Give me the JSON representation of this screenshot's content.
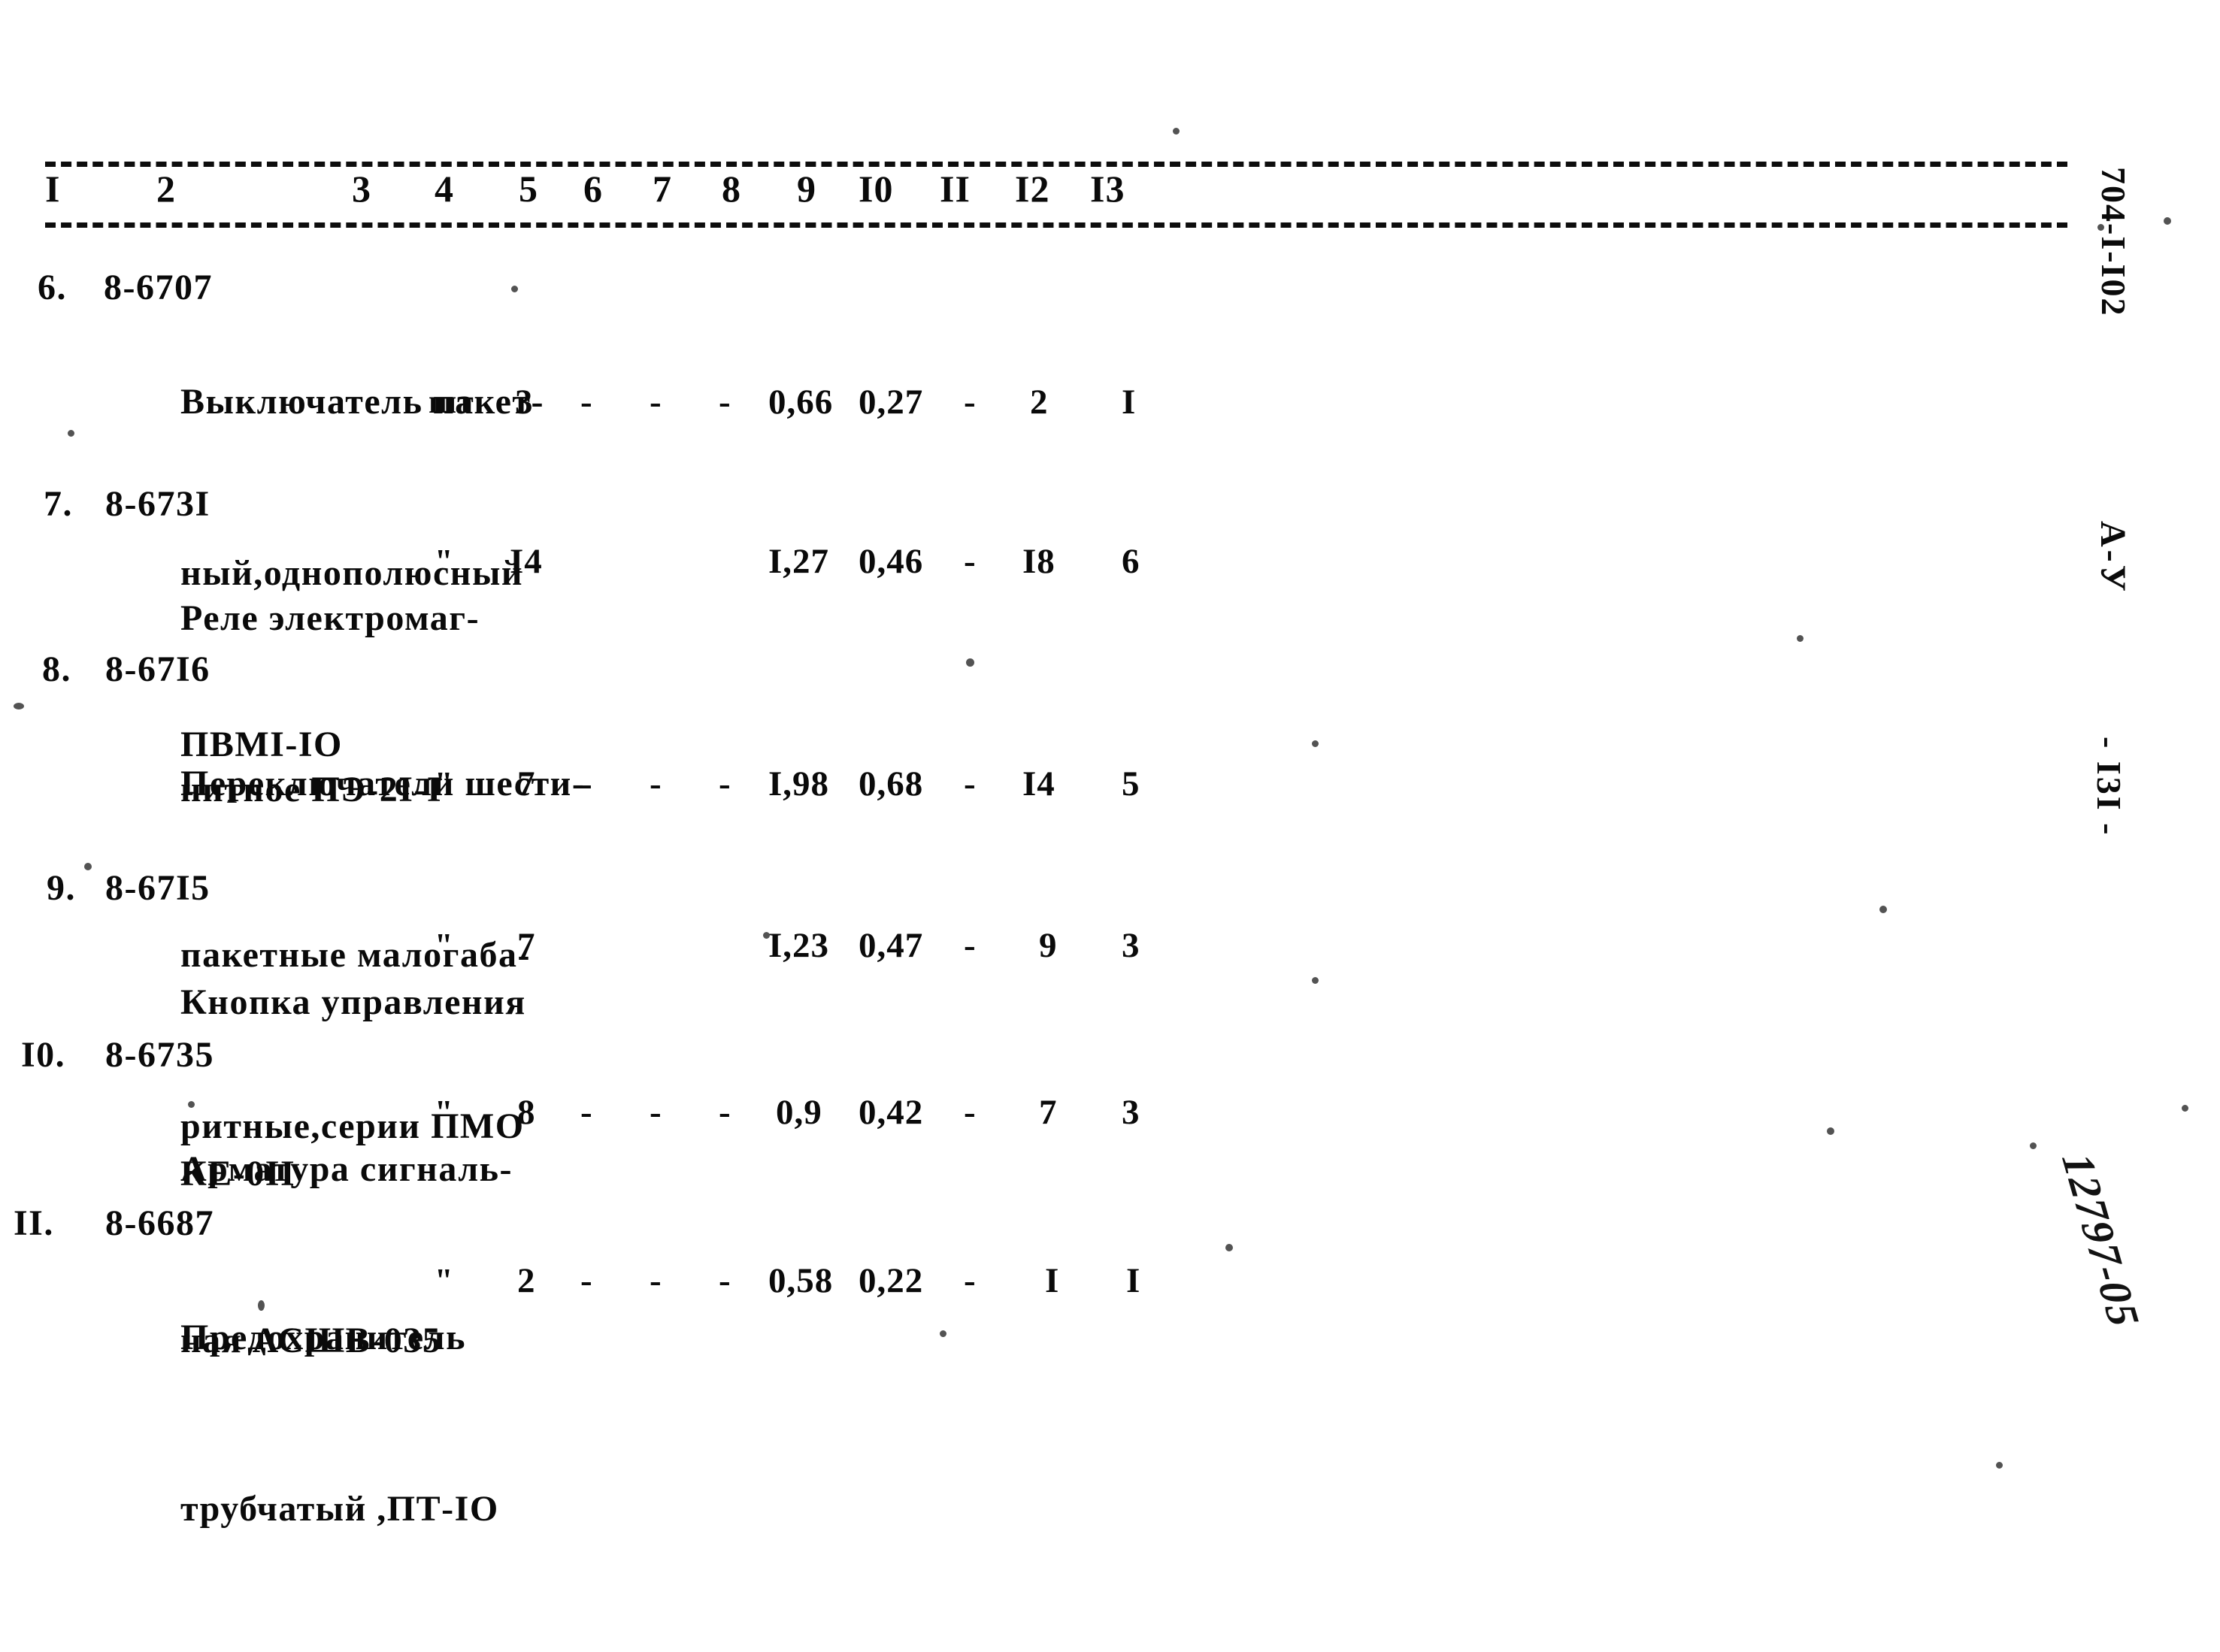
{
  "document": {
    "code": "704-I-I02",
    "series": "А-У",
    "page_label": "- I3I -",
    "archive_stamp": "12797-05"
  },
  "table": {
    "column_numbers": [
      "I",
      "2",
      "3",
      "4",
      "5",
      "6",
      "7",
      "8",
      "9",
      "I0",
      "II",
      "I2",
      "I3"
    ],
    "rows": [
      {
        "index": "6.",
        "code": "8-6707",
        "name_lines": [
          "Выключатель пакет-",
          "ный,однополюсный",
          "ПВМI-IO"
        ],
        "unit": "шт",
        "c5": "3",
        "c6": "-",
        "c7": "-",
        "c8": "-",
        "c9": "0,66",
        "c10": "0,27",
        "c11": "-",
        "c12": "2",
        "c13": "I"
      },
      {
        "index": "7.",
        "code": "8-673I",
        "name_lines": [
          "Реле электромаг-",
          "нитное ПЭ-2I-I"
        ],
        "unit": "\"",
        "c5": "I4",
        "c6": "",
        "c7": "",
        "c8": "",
        "c9": "I,27",
        "c10": "0,46",
        "c11": "-",
        "c12": "I8",
        "c13": "6"
      },
      {
        "index": "8.",
        "code": "8-67I6",
        "name_lines": [
          "Переключатели шести-",
          "пакетные малогаба-",
          "ритные,серии ПМО"
        ],
        "unit": "\"",
        "c5": "7",
        "c6": "-",
        "c7": "-",
        "c8": "-",
        "c9": "I,98",
        "c10": "0,68",
        "c11": "-",
        "c12": "I4",
        "c13": "5"
      },
      {
        "index": "9.",
        "code": "8-67I5",
        "name_lines": [
          "Кнопка управления",
          "КЕ-0II"
        ],
        "unit": "\"",
        "c5": "7",
        "c6": "",
        "c7": "",
        "c8": "",
        "c9": "I,23",
        "c10": "0,47",
        "c11": "-",
        "c12": "9",
        "c13": "3"
      },
      {
        "index": "I0.",
        "code": "8-6735",
        "name_lines": [
          "Арматура сигналь-",
          "ная АСШВ-035"
        ],
        "unit": "\"",
        "c5": "8",
        "c6": "-",
        "c7": "-",
        "c8": "-",
        "c9": "0,9",
        "c10": "0,42",
        "c11": "-",
        "c12": "7",
        "c13": "3"
      },
      {
        "index": "II.",
        "code": "8-6687",
        "name_lines": [
          "Предохранитель",
          "трубчатый ,ПТ-IO"
        ],
        "unit": "\"",
        "c5": "2",
        "c6": "-",
        "c7": "-",
        "c8": "-",
        "c9": "0,58",
        "c10": "0,22",
        "c11": "-",
        "c12": "I",
        "c13": "I"
      }
    ]
  }
}
